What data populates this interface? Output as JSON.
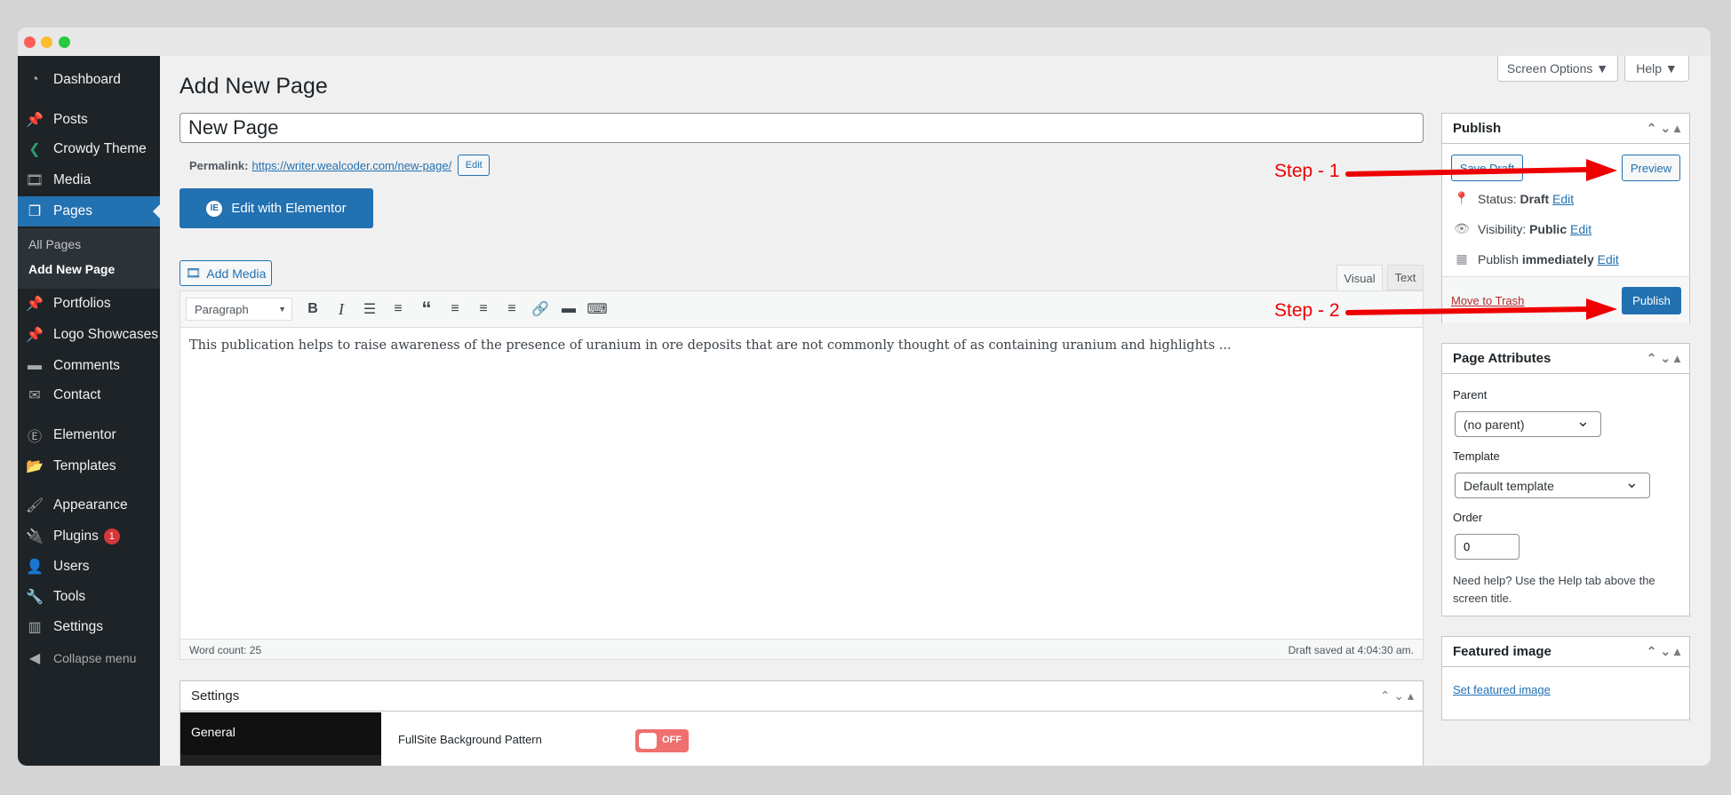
{
  "sidebar": {
    "items": [
      {
        "label": "Dashboard",
        "icon": "dashboard-icon"
      },
      {
        "label": "Posts",
        "icon": "pin-icon"
      },
      {
        "label": "Crowdy Theme",
        "icon": "crowdy-logo-icon"
      },
      {
        "label": "Media",
        "icon": "media-icon"
      },
      {
        "label": "Pages",
        "icon": "pages-icon",
        "active": true
      },
      {
        "label": "Portfolios",
        "icon": "pin-icon"
      },
      {
        "label": "Logo Showcases",
        "icon": "pin-icon"
      },
      {
        "label": "Comments",
        "icon": "comment-icon"
      },
      {
        "label": "Contact",
        "icon": "mail-icon"
      },
      {
        "label": "Elementor",
        "icon": "elementor-icon"
      },
      {
        "label": "Templates",
        "icon": "folder-icon"
      },
      {
        "label": "Appearance",
        "icon": "brush-icon"
      },
      {
        "label": "Plugins",
        "icon": "plugin-icon",
        "badge": "1"
      },
      {
        "label": "Users",
        "icon": "user-icon"
      },
      {
        "label": "Tools",
        "icon": "wrench-icon"
      },
      {
        "label": "Settings",
        "icon": "settings-icon"
      },
      {
        "label": "Collapse menu",
        "icon": "collapse-icon"
      }
    ],
    "submenu": [
      "All Pages",
      "Add New Page"
    ]
  },
  "header": {
    "title": "Add New Page",
    "screen_options": "Screen Options ▼",
    "help": "Help ▼"
  },
  "editor": {
    "title_value": "New Page",
    "permalink_label": "Permalink:",
    "permalink_url": "https://writer.wealcoder.com/new-page/",
    "permalink_edit": "Edit",
    "elementor_button": "Edit with Elementor",
    "add_media": "Add Media",
    "tab_visual": "Visual",
    "tab_text": "Text",
    "format_select": "Paragraph",
    "content": "This publication helps to raise awareness of the presence of uranium in ore deposits that are not commonly thought of as containing uranium and highlights ...",
    "word_count": "Word count: 25",
    "draft_saved": "Draft saved at 4:04:30 am."
  },
  "settings_box": {
    "title": "Settings",
    "tab_general": "General",
    "field_label": "FullSite Background Pattern",
    "toggle": "OFF",
    "toggle_on": false
  },
  "publish": {
    "title": "Publish",
    "save_draft": "Save Draft",
    "preview": "Preview",
    "status_label": "Status:",
    "status_value": "Draft",
    "visibility_label": "Visibility:",
    "visibility_value": "Public",
    "publish_label": "Publish",
    "publish_value": "immediately",
    "edit": "Edit",
    "trash": "Move to Trash",
    "publish_button": "Publish"
  },
  "attributes": {
    "title": "Page Attributes",
    "parent_label": "Parent",
    "parent_value": "(no parent)",
    "template_label": "Template",
    "template_value": "Default template",
    "order_label": "Order",
    "order_value": "0",
    "help": "Need help? Use the Help tab above the screen title."
  },
  "featured": {
    "title": "Featured image",
    "link": "Set featured image"
  },
  "annotations": {
    "step1": "Step - 1",
    "step2": "Step - 2",
    "color": "#e00000"
  },
  "colors": {
    "accent": "#2271b1",
    "sidebar": "#1d2327",
    "toggle_off": "#f06f6f"
  }
}
